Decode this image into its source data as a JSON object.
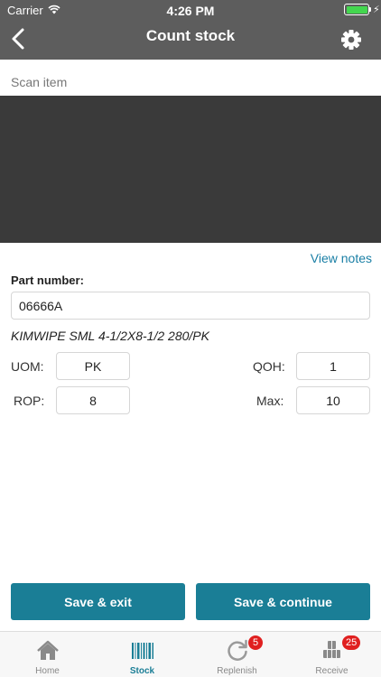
{
  "status_bar": {
    "carrier": "Carrier",
    "time": "4:26 PM"
  },
  "header": {
    "title": "Count stock"
  },
  "scan": {
    "label": "Scan item"
  },
  "notes": {
    "link_label": "View notes"
  },
  "part": {
    "label": "Part number:",
    "value": "06666A",
    "description": "KIMWIPE SML 4-1/2X8-1/2 280/PK"
  },
  "fields": {
    "uom_label": "UOM:",
    "uom_value": "PK",
    "qoh_label": "QOH:",
    "qoh_value": "1",
    "rop_label": "ROP:",
    "rop_value": "8",
    "max_label": "Max:",
    "max_value": "10"
  },
  "actions": {
    "save_exit": "Save & exit",
    "save_continue": "Save & continue"
  },
  "tabs": [
    {
      "label": "Home"
    },
    {
      "label": "Stock"
    },
    {
      "label": "Replenish",
      "badge": "5"
    },
    {
      "label": "Receive",
      "badge": "25"
    }
  ],
  "colors": {
    "accent": "#1a7e96",
    "header": "#5d5d5d",
    "camera": "#3a3a3a",
    "badge": "#e02020",
    "battery": "#43d64f"
  }
}
